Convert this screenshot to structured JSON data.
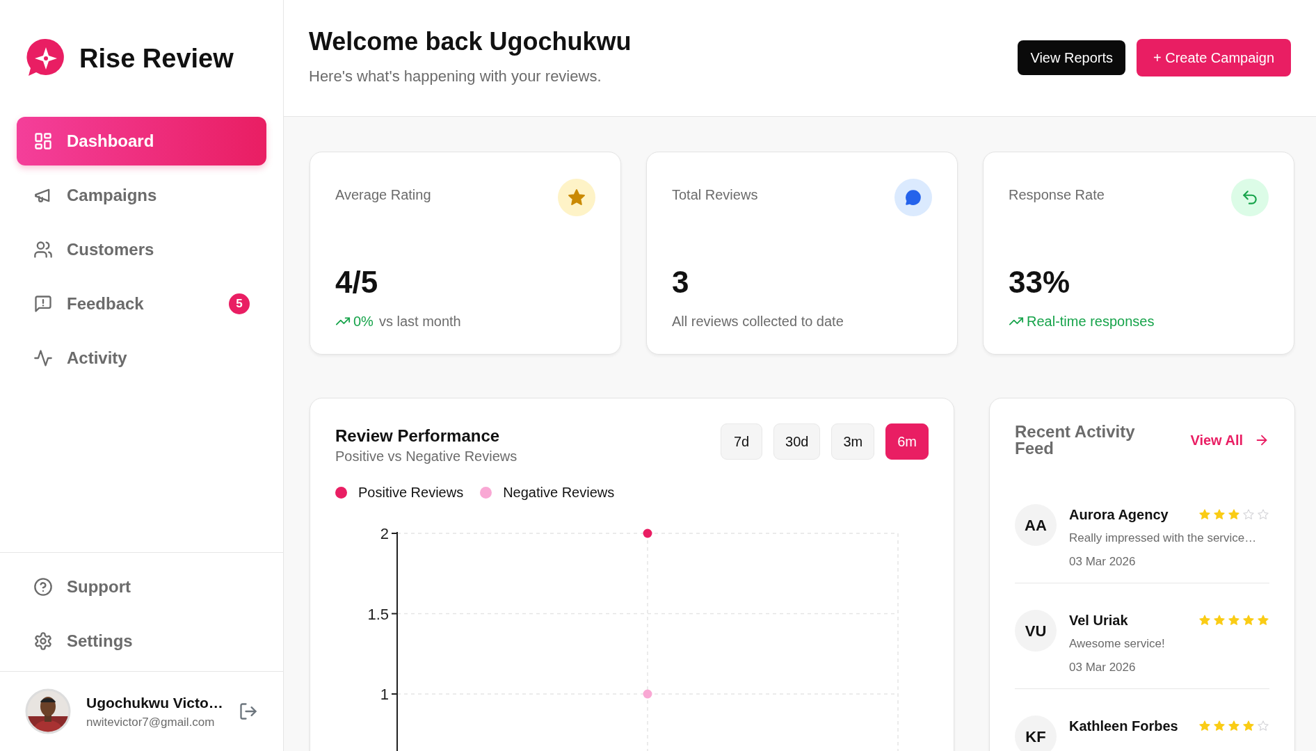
{
  "app": {
    "name": "Rise Review"
  },
  "sidebar": {
    "items": [
      {
        "label": "Dashboard",
        "selected": true
      },
      {
        "label": "Campaigns",
        "selected": false
      },
      {
        "label": "Customers",
        "selected": false
      },
      {
        "label": "Feedback",
        "selected": false,
        "badge": "5"
      },
      {
        "label": "Activity",
        "selected": false
      }
    ],
    "footer_items": [
      {
        "label": "Support"
      },
      {
        "label": "Settings"
      }
    ]
  },
  "user": {
    "name": "Ugochukwu Victo…",
    "email": "nwitevictor7@gmail.com"
  },
  "header": {
    "title": "Welcome back Ugochukwu",
    "subtitle": "Here's what's happening with your reviews.",
    "buttons": [
      {
        "label": "View Reports",
        "kind": "dark"
      },
      {
        "label": "+ Create Campaign",
        "kind": "primary"
      }
    ]
  },
  "stats": [
    {
      "kind": "rating",
      "label": "Average Rating",
      "value": "4/5",
      "trend": "0%",
      "note": "vs last month"
    },
    {
      "kind": "reviews",
      "label": "Total Reviews",
      "value": "3",
      "note": "All reviews collected to date"
    },
    {
      "kind": "response",
      "label": "Response Rate",
      "value": "33%",
      "trend": "Real-time responses"
    }
  ],
  "performance": {
    "title": "Review Performance",
    "subtitle": "Positive vs Negative Reviews",
    "ranges": [
      {
        "label": "7d",
        "selected": false
      },
      {
        "label": "30d",
        "selected": false
      },
      {
        "label": "3m",
        "selected": false
      },
      {
        "label": "6m",
        "selected": true
      }
    ],
    "chart_data": {
      "type": "line",
      "grid": true,
      "ylim": [
        0,
        2
      ],
      "yticks": [
        1,
        1.5,
        2
      ],
      "series": [
        {
          "name": "Positive Reviews",
          "color": "#e91e63",
          "marker": true,
          "values": [
            null,
            2,
            null
          ]
        },
        {
          "name": "Negative Reviews",
          "color": "#f9a8d4",
          "marker": true,
          "values": [
            null,
            1,
            null
          ]
        }
      ]
    }
  },
  "activity": {
    "title": "Recent Activity Feed",
    "link": "View All",
    "items": [
      {
        "initials": "AA",
        "name": "Aurora Agency",
        "stars": 3,
        "text": "Really impressed with the service…",
        "date": "03 Mar 2026"
      },
      {
        "initials": "VU",
        "name": "Vel Uriak",
        "stars": 5,
        "text": "Awesome service!",
        "date": "03 Mar 2026"
      },
      {
        "initials": "KF",
        "name": "Kathleen Forbes",
        "stars": 4
      }
    ]
  }
}
